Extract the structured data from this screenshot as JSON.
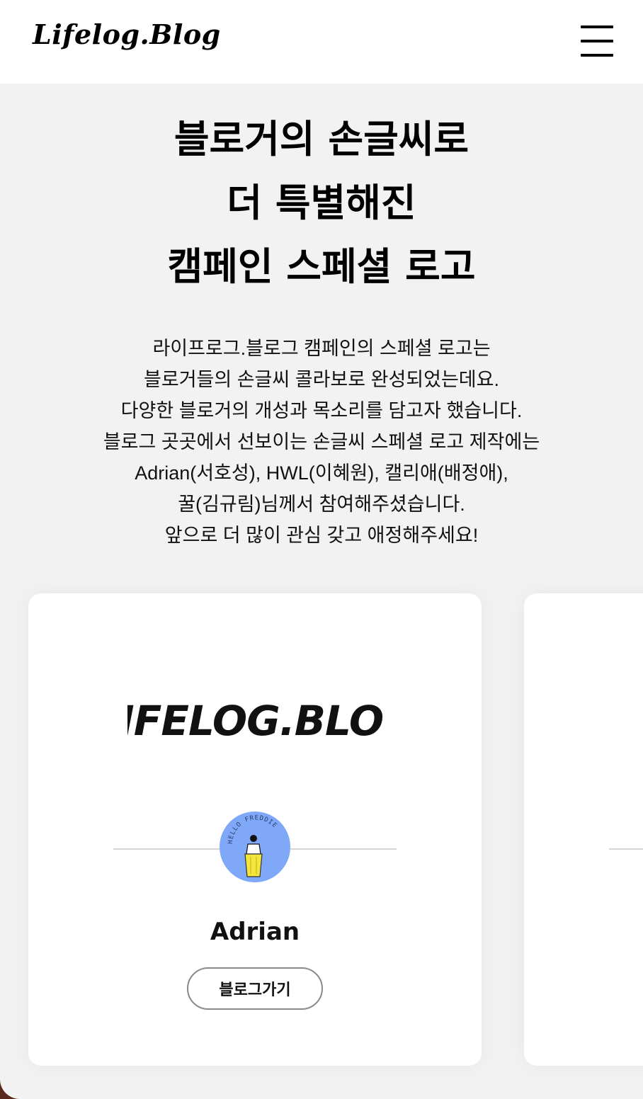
{
  "header": {
    "logo": "Lifelog.Blog",
    "menu_icon": "hamburger-menu-icon"
  },
  "hero": {
    "title_lines": [
      "블로거의 손글씨로",
      "더 특별해진",
      "캠페인 스페셜 로고"
    ]
  },
  "description": {
    "lines": [
      "라이프로그.블로그 캠페인의 스페셜 로고는",
      "블로거들의 손글씨 콜라보로 완성되었는데요.",
      "다양한 블로거의 개성과 목소리를 담고자 했습니다.",
      "블로그 곳곳에서 선보이는 손글씨 스페셜 로고 제작에는",
      "Adrian(서호성), HWL(이혜원), 캘리애(배정애),",
      "꿀(김규림)님께서 참여해주셨습니다.",
      "앞으로 더 많이 관심 갖고 애정해주세요!"
    ]
  },
  "cards": [
    {
      "logo_text": "LIFELOG.BLOG",
      "avatar_text": "HELLO FREDDIE",
      "name": "Adrian",
      "button_label": "블로그가기"
    }
  ],
  "colors": {
    "page_bg": "#f2f2f2",
    "card_bg": "#ffffff",
    "avatar_bg": "#80a8f8",
    "avatar_cup": "#f4e53a"
  }
}
